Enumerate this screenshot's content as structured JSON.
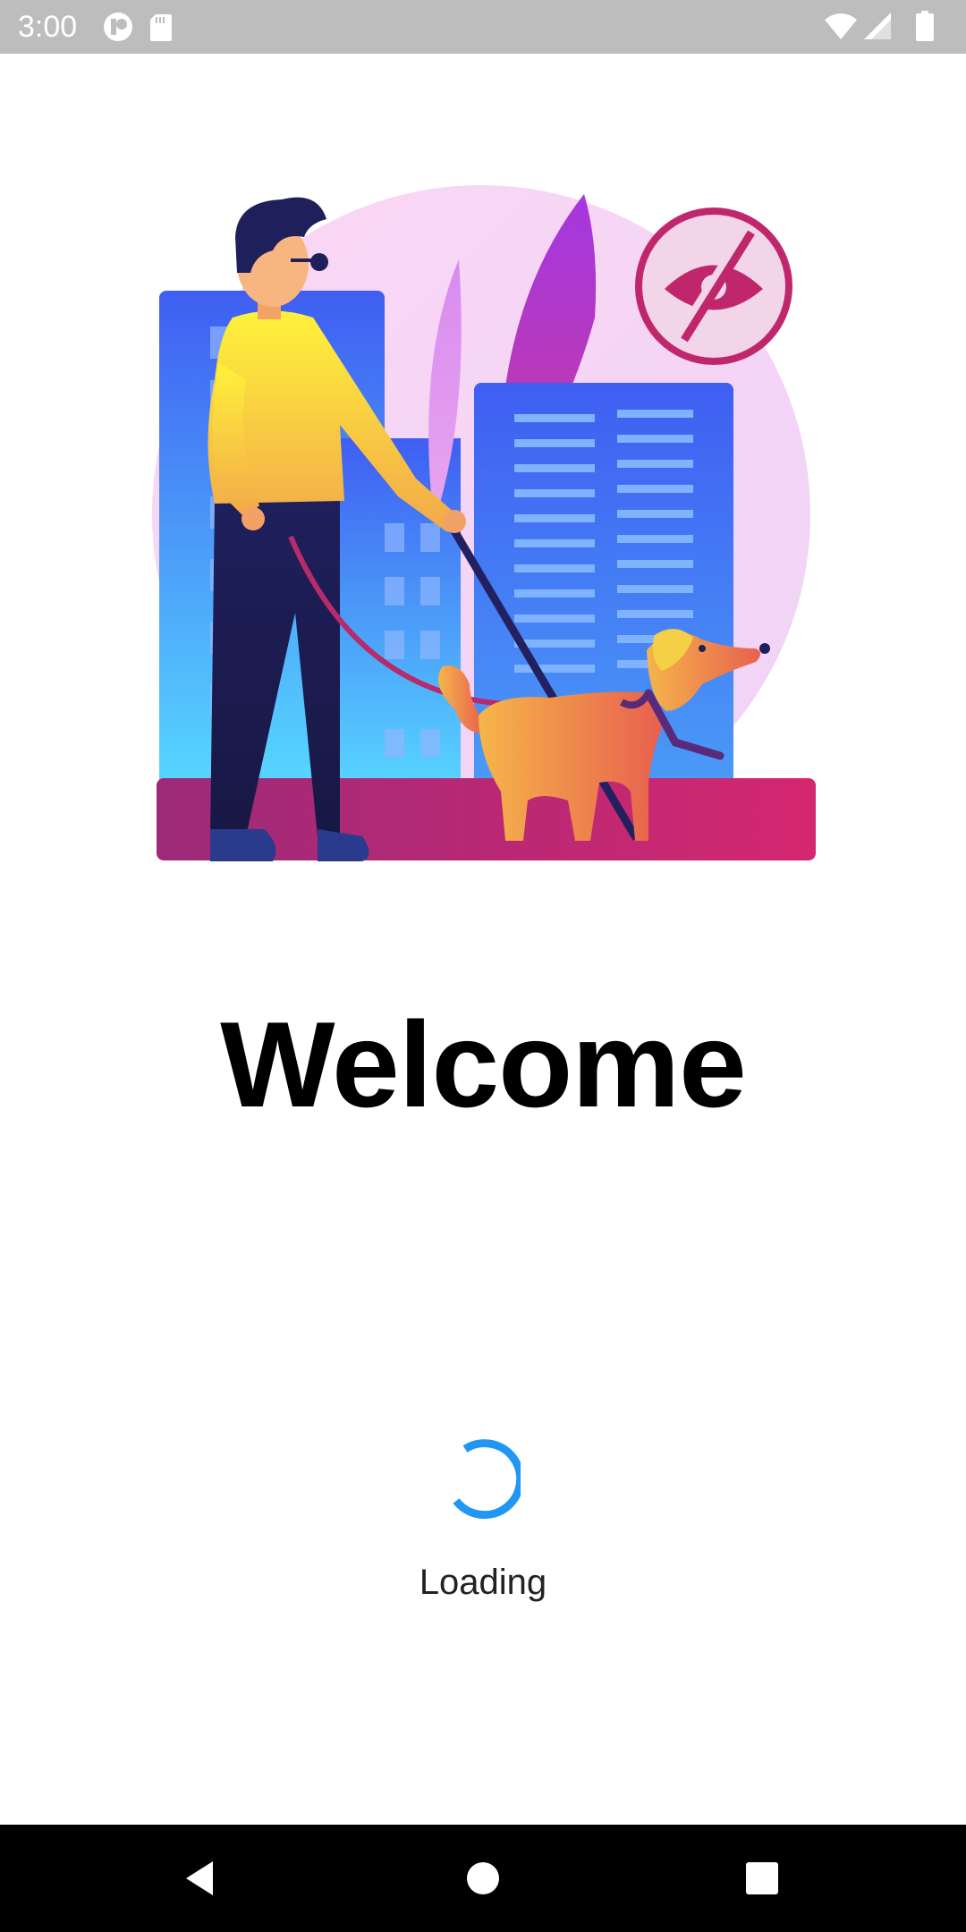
{
  "status_bar": {
    "time": "3:00",
    "background": "#bdbdbd",
    "icons_left": [
      "notification-app-icon",
      "sd-card-icon"
    ],
    "icons_right": [
      "wifi-icon",
      "signal-icon",
      "battery-icon"
    ]
  },
  "illustration": {
    "icon": "man-with-guide-dog-illustration",
    "badge_icon": "eye-slash-icon"
  },
  "main": {
    "title": "Welcome",
    "loading_label": "Loading",
    "spinner_color": "#2196f3"
  },
  "nav_bar": {
    "background": "#000000",
    "icons": [
      "back-icon",
      "home-icon",
      "recents-icon"
    ]
  }
}
